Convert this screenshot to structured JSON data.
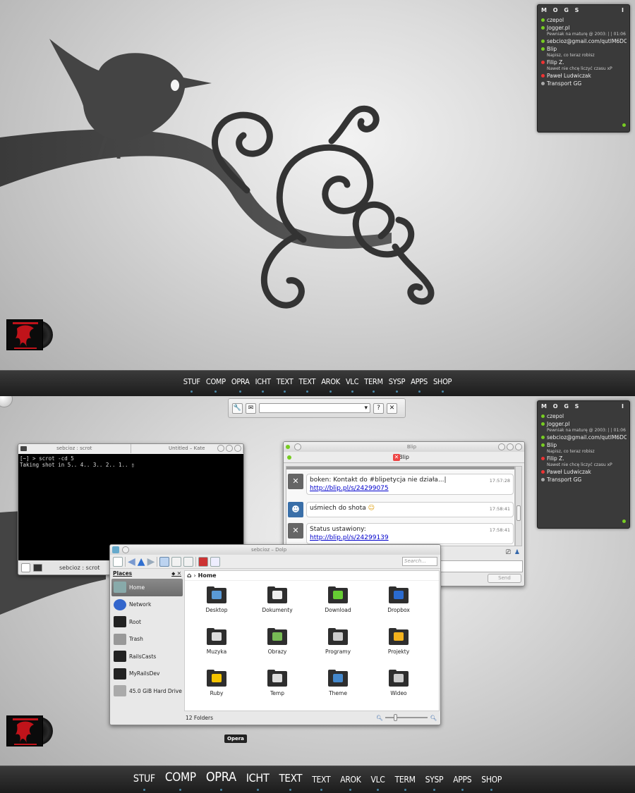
{
  "dock": {
    "items": [
      "STUF",
      "COMP",
      "OPRA",
      "ICHT",
      "TEXT",
      "TEXT",
      "AROK",
      "VLC",
      "TERM",
      "SYSP",
      "APPS",
      "SHOP"
    ]
  },
  "mogs": {
    "title": "M O G S",
    "info_icon": "I",
    "contacts": [
      {
        "name": "czepol",
        "desc": "",
        "status_color": "#7c2"
      },
      {
        "name": "Jogger.pl",
        "desc": "Pewniak na maturę @ 2003: | | 01:06 +",
        "status_color": "#7c2"
      },
      {
        "name": "sebcioz@gmail.com/qutIM6DC...",
        "desc": "",
        "status_color": "#7c2"
      },
      {
        "name": "Blip",
        "desc": "Napisz, co teraz robisz",
        "status_color": "#7c2"
      },
      {
        "name": "Filip Z.",
        "desc": "Nawet nie chcę liczyć czasu xP",
        "status_color": "#e33"
      },
      {
        "name": "Paweł Ludwiczak",
        "desc": "",
        "status_color": "#e33"
      },
      {
        "name": "Transport GG",
        "desc": "",
        "status_color": "#aaa"
      }
    ]
  },
  "konsole": {
    "tab1": "sebcioz : scrot",
    "tab2": "Untitled – Kate",
    "terminal_text": "[~] > scrot -cd 5\nTaking shot in 5.. 4.. 3.. 2.. 1.. ▯",
    "taskbar_label": "sebcioz : scrot"
  },
  "blip": {
    "window_title": "Blip",
    "tab_label": "Blip",
    "close_glyph": "✕",
    "messages": [
      {
        "text": "boken: Kontakt do #blipetycja nie działa...| ",
        "link": "http://blip.pl/s/24299075",
        "time": "17:57:28"
      },
      {
        "text": "uśmiech do shota ",
        "link": "",
        "time": "17:58:41"
      },
      {
        "text": "Status ustawiony: ",
        "link": "http://blip.pl/s/24299139",
        "time": "17:58:41"
      }
    ],
    "send_label": "Send"
  },
  "dolphin": {
    "title": "sebcioz – Dolp",
    "search_placeholder": "Search...",
    "places_label": "Places",
    "places": [
      "Home",
      "Network",
      "Root",
      "Trash",
      "RailsCasts",
      "MyRailsDev",
      "45.0 GiB Hard Drive"
    ],
    "breadcrumb": "Home",
    "folders": [
      "Desktop",
      "Dokumenty",
      "Download",
      "Dropbox",
      "Muzyka",
      "Obrazy",
      "Programy",
      "Projekty",
      "Ruby",
      "Temp",
      "Theme",
      "Wideo"
    ],
    "status": "12 Folders"
  },
  "tooltip": "Opera",
  "colors": {
    "dock_bg": "#1c1c1c",
    "link": "#0000cc",
    "online": "#77cc22",
    "busy": "#ee3333"
  }
}
